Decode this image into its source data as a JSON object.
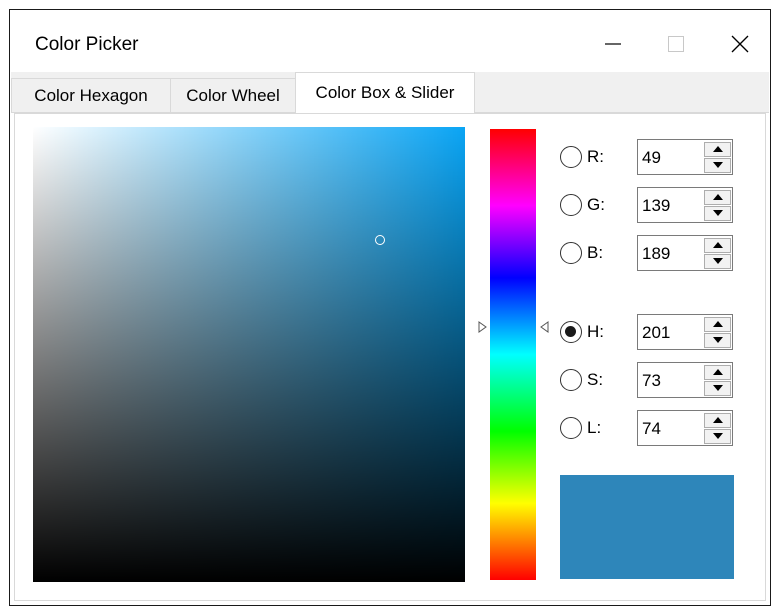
{
  "window": {
    "title": "Color Picker"
  },
  "caption_buttons": {
    "minimize": "minimize-icon",
    "maximize": "maximize-icon",
    "close": "close-icon"
  },
  "tabs": [
    {
      "label": "Color Hexagon",
      "selected": false
    },
    {
      "label": "Color Wheel",
      "selected": false
    },
    {
      "label": "Color Box & Slider",
      "selected": true
    }
  ],
  "fields": {
    "r": {
      "label": "R:",
      "value": "49",
      "checked": false
    },
    "g": {
      "label": "G:",
      "value": "139",
      "checked": false
    },
    "b": {
      "label": "B:",
      "value": "189",
      "checked": false
    },
    "h": {
      "label": "H:",
      "value": "201",
      "checked": true
    },
    "s": {
      "label": "S:",
      "value": "73",
      "checked": false
    },
    "l": {
      "label": "L:",
      "value": "74",
      "checked": false
    }
  },
  "colors": {
    "current": "#2e86ba",
    "box_hue": "#0aa5f5"
  }
}
